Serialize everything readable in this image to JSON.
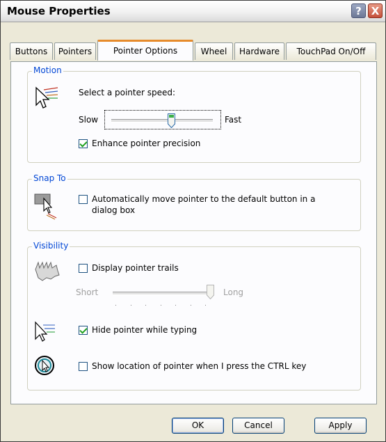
{
  "window": {
    "title": "Mouse Properties",
    "help_glyph": "?",
    "close_glyph": "X"
  },
  "tabs": [
    "Buttons",
    "Pointers",
    "Pointer Options",
    "Wheel",
    "Hardware",
    "TouchPad On/Off"
  ],
  "active_tab": "Pointer Options",
  "motion": {
    "group_label": "Motion",
    "speed_label": "Select a pointer speed:",
    "slow_label": "Slow",
    "fast_label": "Fast",
    "speed_value_fraction": 0.6,
    "precision_label": "Enhance pointer precision",
    "precision_checked": true
  },
  "snap_to": {
    "group_label": "Snap To",
    "line1": "Automatically move pointer to the default button in a",
    "line2": "dialog box",
    "checked": false
  },
  "visibility": {
    "group_label": "Visibility",
    "trails_label": "Display pointer trails",
    "trails_checked": false,
    "short_label": "Short",
    "long_label": "Long",
    "trails_value_fraction": 1.0,
    "hide_label": "Hide pointer while typing",
    "hide_checked": true,
    "show_location_label": "Show location of pointer when I press the CTRL key",
    "show_location_checked": false
  },
  "buttons": {
    "ok": "OK",
    "cancel": "Cancel",
    "apply": "Apply"
  },
  "colors": {
    "accent_tab": "#e68b2c",
    "group_label": "#0046d5",
    "check": "#21a121"
  }
}
